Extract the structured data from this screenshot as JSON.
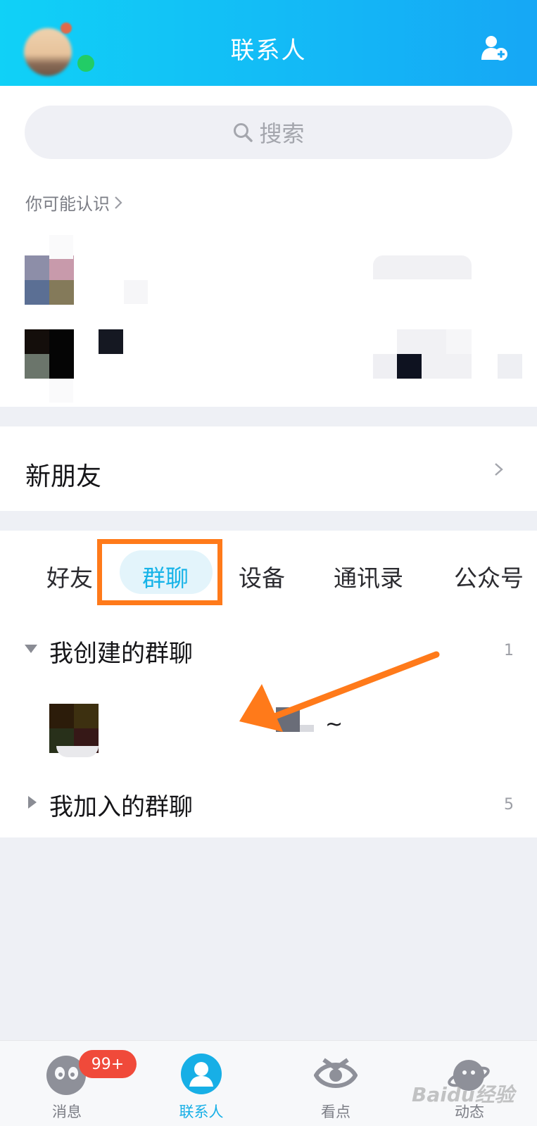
{
  "header": {
    "title": "联系人"
  },
  "search": {
    "label": "搜索"
  },
  "suggestions": {
    "label": "你可能认识"
  },
  "new_friends": {
    "label": "新朋友"
  },
  "tabs": [
    {
      "label": "好友"
    },
    {
      "label": "群聊"
    },
    {
      "label": "设备"
    },
    {
      "label": "通讯录"
    },
    {
      "label": "公众号"
    }
  ],
  "groups": {
    "created": {
      "label": "我创建的群聊",
      "count": "1",
      "item_suffix": "~"
    },
    "joined": {
      "label": "我加入的群聊",
      "count": "5"
    }
  },
  "bottom_nav": {
    "messages": {
      "label": "消息",
      "badge": "99+"
    },
    "contacts": {
      "label": "联系人"
    },
    "watch": {
      "label": "看点"
    },
    "feed": {
      "label": "动态"
    }
  },
  "watermark": "Baidu经验",
  "colors": {
    "header_start": "#10d1f7",
    "header_end": "#16a7f5",
    "accent": "#16b3e8",
    "annotation": "#ff7a1a",
    "badge": "#f04a3a",
    "online": "#22cc66"
  },
  "icons": [
    "add-user-icon",
    "search-icon",
    "chevron-right-icon",
    "triangle-down-icon",
    "triangle-right-icon",
    "message-icon",
    "contacts-icon",
    "eye-icon",
    "planet-icon"
  ]
}
